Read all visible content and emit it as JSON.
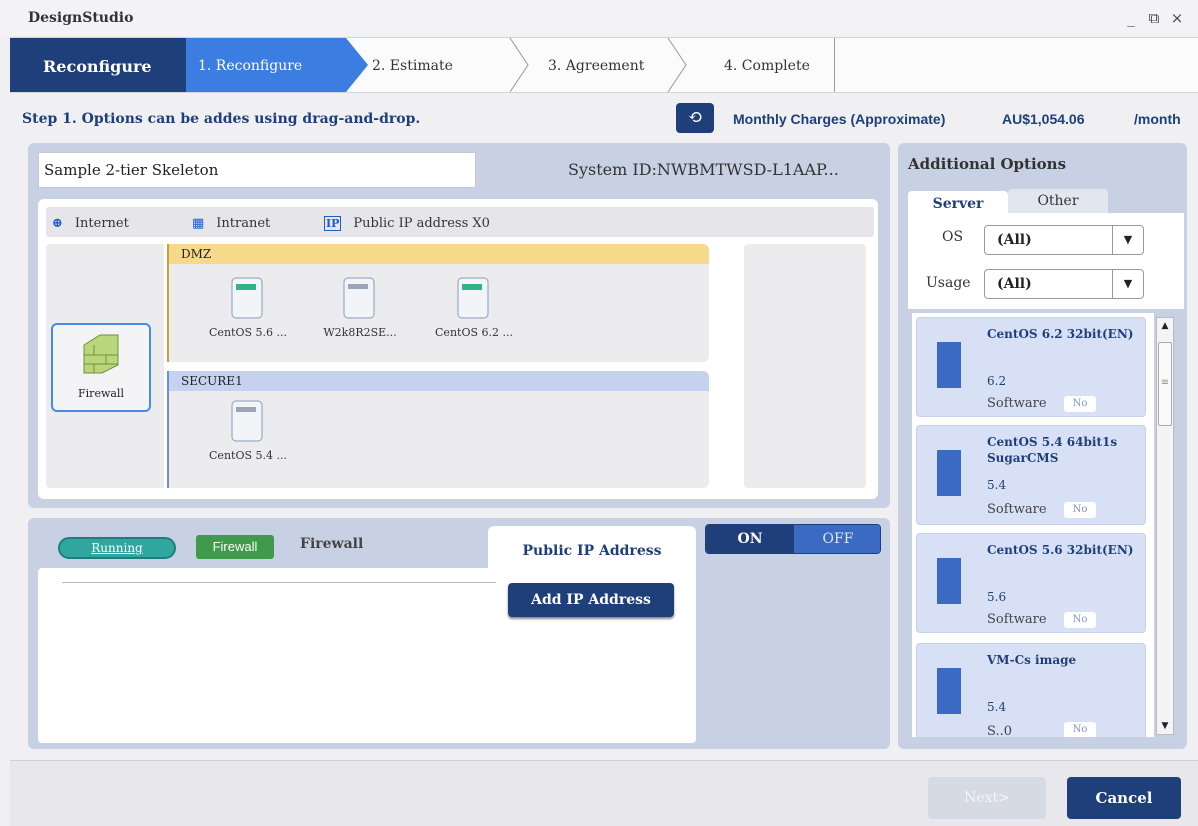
{
  "window": {
    "title": "DesignStudio",
    "minimize": "_",
    "restore": "⧉",
    "close": "×"
  },
  "wizard": {
    "title": "Reconfigure",
    "steps": [
      "1. Reconfigure",
      "2. Estimate",
      "3. Agreement",
      "4. Complete"
    ]
  },
  "step_text": "Step 1. Options can be addes using drag-and-drop.",
  "charges": {
    "label": "Monthly Charges (Approximate)",
    "amount": "AU$1,054.06",
    "unit": "/month"
  },
  "system": {
    "name": "Sample 2-tier Skeleton",
    "id": "System ID:NWBMTWSD-L1AAP..."
  },
  "network": {
    "internet": "Internet",
    "intranet": "Intranet",
    "public_ip": "Public IP address X0"
  },
  "firewall_node": {
    "label": "Firewall"
  },
  "segments": {
    "dmz": {
      "label": "DMZ",
      "servers": [
        "CentOS 5.6 ...",
        "W2k8R2SE...",
        "CentOS 6.2 ..."
      ]
    },
    "secure": {
      "label": "SECURE1",
      "servers": [
        "CentOS 5.4 ..."
      ]
    }
  },
  "detail": {
    "status": "Running",
    "type_badge": "Firewall",
    "name": "Firewall",
    "tab": "Public IP Address",
    "toggle_on": "ON",
    "toggle_off": "OFF",
    "add_ip": "Add IP Address"
  },
  "options": {
    "title": "Additional Options",
    "tabs": [
      "Server",
      "Other"
    ],
    "os_label": "OS",
    "os_value": "(All)",
    "usage_label": "Usage",
    "usage_value": "(All)",
    "items": [
      {
        "name": "CentOS 6.2 32bit(EN)",
        "version": "6.2",
        "category": "Software",
        "badge": "No"
      },
      {
        "name": "CentOS 5.4 64bit1s SugarCMS",
        "version": "5.4",
        "category": "Software",
        "badge": "No"
      },
      {
        "name": "CentOS 5.6 32bit(EN)",
        "version": "5.6",
        "category": "Software",
        "badge": "No"
      },
      {
        "name": "VM-Cs image",
        "version": "5.4",
        "category": "S..0",
        "badge": "No"
      }
    ]
  },
  "footer": {
    "next": "Next>",
    "cancel": "Cancel"
  },
  "colors": {
    "navy": "#1e3f7a",
    "accent": "#3b7de0",
    "panel": "#c8d0e4",
    "dmz": "#f7d98c",
    "secure": "#c6d2ef"
  }
}
